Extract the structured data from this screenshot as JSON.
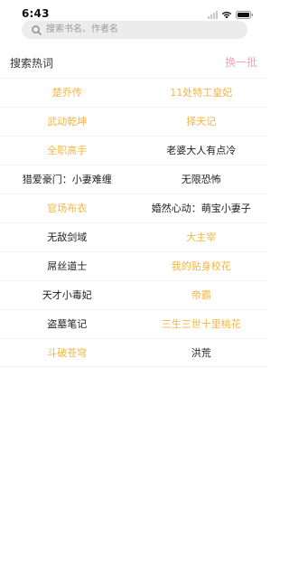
{
  "status_bar": {
    "time": "6:43"
  },
  "search": {
    "placeholder": "搜索书名、作者名"
  },
  "section": {
    "title": "搜索热词",
    "refresh_label": "换一批"
  },
  "colors": {
    "hot": "#f4b53f",
    "normal": "#222222",
    "accent": "#f2a5b8"
  },
  "hot_words": [
    {
      "left": {
        "text": "楚乔传",
        "hot": true
      },
      "right": {
        "text": "11处特工皇妃",
        "hot": true
      }
    },
    {
      "left": {
        "text": "武动乾坤",
        "hot": true
      },
      "right": {
        "text": "择天记",
        "hot": true
      }
    },
    {
      "left": {
        "text": "全职高手",
        "hot": true
      },
      "right": {
        "text": "老婆大人有点冷",
        "hot": false
      }
    },
    {
      "left": {
        "text": "猎爱豪门：小妻难缠",
        "hot": false
      },
      "right": {
        "text": "无限恐怖",
        "hot": false
      }
    },
    {
      "left": {
        "text": "官场布衣",
        "hot": true
      },
      "right": {
        "text": "婚然心动：萌宝小妻子",
        "hot": false
      }
    },
    {
      "left": {
        "text": "无敌剑域",
        "hot": false
      },
      "right": {
        "text": "大主宰",
        "hot": true
      }
    },
    {
      "left": {
        "text": "屌丝道士",
        "hot": false
      },
      "right": {
        "text": "我的贴身校花",
        "hot": true
      }
    },
    {
      "left": {
        "text": "天才小毒妃",
        "hot": false
      },
      "right": {
        "text": "帝霸",
        "hot": true
      }
    },
    {
      "left": {
        "text": "盗墓笔记",
        "hot": false
      },
      "right": {
        "text": "三生三世十里桃花",
        "hot": true
      }
    },
    {
      "left": {
        "text": "斗破苍穹",
        "hot": true
      },
      "right": {
        "text": "洪荒",
        "hot": false
      }
    }
  ]
}
